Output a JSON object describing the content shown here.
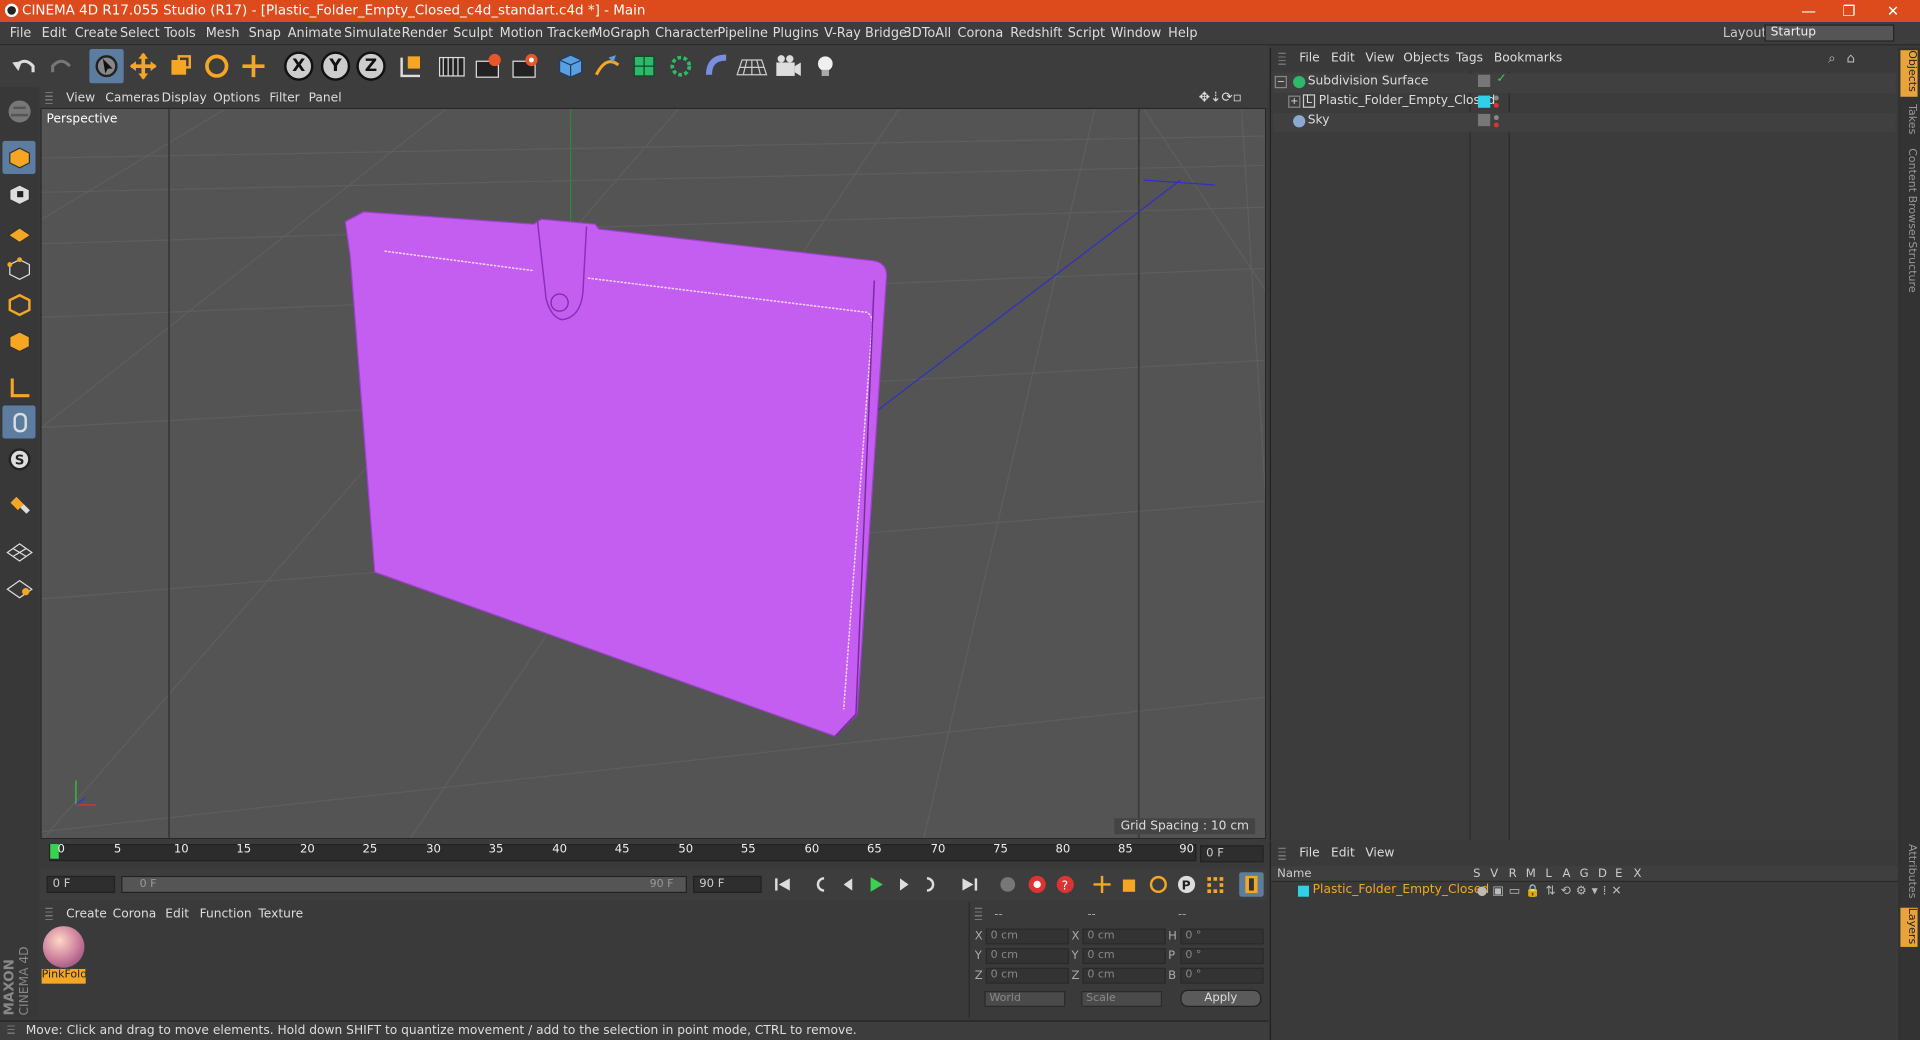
{
  "window": {
    "title": "CINEMA 4D R17.055 Studio (R17) - [Plastic_Folder_Empty_Closed_c4d_standart.c4d *] - Main",
    "min": "—",
    "restore": "❐",
    "close": "✕"
  },
  "menu": {
    "items": [
      "File",
      "Edit",
      "Create",
      "Select",
      "Tools",
      "Mesh",
      "Snap",
      "Animate",
      "Simulate",
      "Render",
      "Sculpt",
      "Motion Tracker",
      "MoGraph",
      "Character",
      "Pipeline",
      "Plugins",
      "V-Ray Bridge",
      "3DToAll",
      "Corona",
      "Redshift",
      "Script",
      "Window",
      "Help"
    ],
    "layout_label": "Layout:",
    "layout_value": "Startup"
  },
  "toolbar": {
    "icons": [
      "undo-icon",
      "redo-icon",
      "select-arrow-icon",
      "move-icon",
      "scale-icon",
      "rotate-icon",
      "live-selection-icon",
      "x-axis-lock",
      "y-axis-lock",
      "z-axis-lock",
      "coordinate-system-icon",
      "render-view-icon",
      "render-picture-viewer-icon",
      "edit-render-settings-icon",
      "cube-primitive-icon",
      "pen-spline-icon",
      "subdivision-surface-icon",
      "array-icon",
      "deformer-icon",
      "floor-icon",
      "camera-icon",
      "light-icon"
    ],
    "x": "X",
    "y": "Y",
    "z": "Z"
  },
  "viewport": {
    "menu": [
      "View",
      "Cameras",
      "Display",
      "Options",
      "Filter",
      "Panel"
    ],
    "label": "Perspective",
    "grid_spacing": "Grid Spacing : 10 cm",
    "object_color": "#c45ef0"
  },
  "timeline": {
    "ticks": [
      "0",
      "5",
      "10",
      "15",
      "20",
      "25",
      "30",
      "35",
      "40",
      "45",
      "50",
      "55",
      "60",
      "65",
      "70",
      "75",
      "80",
      "85",
      "90"
    ],
    "frame_display": "0 F"
  },
  "transport": {
    "start": "0 F",
    "range_start": "0 F",
    "range_end": "90 F",
    "end": "90 F"
  },
  "material_manager": {
    "menu": [
      "Create",
      "Corona",
      "Edit",
      "Function",
      "Texture"
    ],
    "material_name": "PinkFold",
    "brand_top": "MAXON",
    "brand_bottom": "CINEMA 4D"
  },
  "coordinates": {
    "headers": [
      "--",
      "--",
      "--"
    ],
    "rows": [
      {
        "a": "X",
        "v1": "0 cm",
        "b": "X",
        "v2": "0 cm",
        "c": "H",
        "v3": "0 °"
      },
      {
        "a": "Y",
        "v1": "0 cm",
        "b": "Y",
        "v2": "0 cm",
        "c": "P",
        "v3": "0 °"
      },
      {
        "a": "Z",
        "v1": "0 cm",
        "b": "Z",
        "v2": "0 cm",
        "c": "B",
        "v3": "0 °"
      }
    ],
    "mode1": "World",
    "mode2": "Scale",
    "apply": "Apply"
  },
  "object_manager": {
    "menu": [
      "File",
      "Edit",
      "View",
      "Objects",
      "Tags",
      "Bookmarks"
    ],
    "objects": [
      {
        "name": "Subdivision Surface"
      },
      {
        "name": "Plastic_Folder_Empty_Closed"
      },
      {
        "name": "Sky"
      }
    ]
  },
  "layer_manager": {
    "menu": [
      "File",
      "Edit",
      "View"
    ],
    "col_name": "Name",
    "cols": [
      "S",
      "V",
      "R",
      "M",
      "L",
      "A",
      "G",
      "D",
      "E",
      "X"
    ],
    "layer": "Plastic_Folder_Empty_Closed",
    "layer_color": "#2fd0e8"
  },
  "side_tabs": [
    "Objects",
    "Takes",
    "Content Browser",
    "Structure"
  ],
  "side_tabs_bottom": [
    "Attributes",
    "Layers"
  ],
  "status": "Move: Click and drag to move elements. Hold down SHIFT to quantize movement / add to the selection in point mode, CTRL to remove."
}
